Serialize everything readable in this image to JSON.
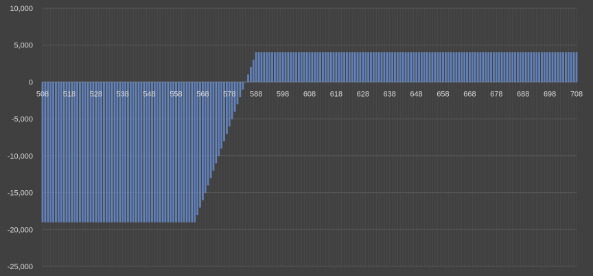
{
  "chart_data": {
    "type": "bar",
    "title": "",
    "xlabel": "",
    "ylabel": "",
    "x_range": [
      508,
      708
    ],
    "ylim": [
      -25000,
      10000
    ],
    "y_ticks": [
      10000,
      5000,
      0,
      -5000,
      -10000,
      -15000,
      -20000,
      -25000
    ],
    "y_tick_labels": [
      "10,000",
      "5,000",
      "0",
      "-5,000",
      "-10,000",
      "-15,000",
      "-20,000",
      "-25,000"
    ],
    "x_tick_labels": [
      "508",
      "518",
      "528",
      "538",
      "548",
      "558",
      "568",
      "578",
      "588",
      "598",
      "608",
      "618",
      "628",
      "638",
      "648",
      "658",
      "668",
      "678",
      "688",
      "698",
      "708"
    ],
    "grid": true,
    "legend": "none",
    "series": [
      {
        "description": "payoff per strike: -19000 for x <= 565, rising linearly by 1000 per unit to 4000 at x >= 588",
        "points": [
          [
            508,
            -19000
          ],
          [
            509,
            -19000
          ],
          [
            510,
            -19000
          ],
          [
            511,
            -19000
          ],
          [
            512,
            -19000
          ],
          [
            513,
            -19000
          ],
          [
            514,
            -19000
          ],
          [
            515,
            -19000
          ],
          [
            516,
            -19000
          ],
          [
            517,
            -19000
          ],
          [
            518,
            -19000
          ],
          [
            519,
            -19000
          ],
          [
            520,
            -19000
          ],
          [
            521,
            -19000
          ],
          [
            522,
            -19000
          ],
          [
            523,
            -19000
          ],
          [
            524,
            -19000
          ],
          [
            525,
            -19000
          ],
          [
            526,
            -19000
          ],
          [
            527,
            -19000
          ],
          [
            528,
            -19000
          ],
          [
            529,
            -19000
          ],
          [
            530,
            -19000
          ],
          [
            531,
            -19000
          ],
          [
            532,
            -19000
          ],
          [
            533,
            -19000
          ],
          [
            534,
            -19000
          ],
          [
            535,
            -19000
          ],
          [
            536,
            -19000
          ],
          [
            537,
            -19000
          ],
          [
            538,
            -19000
          ],
          [
            539,
            -19000
          ],
          [
            540,
            -19000
          ],
          [
            541,
            -19000
          ],
          [
            542,
            -19000
          ],
          [
            543,
            -19000
          ],
          [
            544,
            -19000
          ],
          [
            545,
            -19000
          ],
          [
            546,
            -19000
          ],
          [
            547,
            -19000
          ],
          [
            548,
            -19000
          ],
          [
            549,
            -19000
          ],
          [
            550,
            -19000
          ],
          [
            551,
            -19000
          ],
          [
            552,
            -19000
          ],
          [
            553,
            -19000
          ],
          [
            554,
            -19000
          ],
          [
            555,
            -19000
          ],
          [
            556,
            -19000
          ],
          [
            557,
            -19000
          ],
          [
            558,
            -19000
          ],
          [
            559,
            -19000
          ],
          [
            560,
            -19000
          ],
          [
            561,
            -19000
          ],
          [
            562,
            -19000
          ],
          [
            563,
            -19000
          ],
          [
            564,
            -19000
          ],
          [
            565,
            -19000
          ],
          [
            566,
            -18000
          ],
          [
            567,
            -17000
          ],
          [
            568,
            -16000
          ],
          [
            569,
            -15000
          ],
          [
            570,
            -14000
          ],
          [
            571,
            -13000
          ],
          [
            572,
            -12000
          ],
          [
            573,
            -11000
          ],
          [
            574,
            -10000
          ],
          [
            575,
            -9000
          ],
          [
            576,
            -8000
          ],
          [
            577,
            -7000
          ],
          [
            578,
            -6000
          ],
          [
            579,
            -5000
          ],
          [
            580,
            -4000
          ],
          [
            581,
            -3000
          ],
          [
            582,
            -2000
          ],
          [
            583,
            -1000
          ],
          [
            584,
            0
          ],
          [
            585,
            1000
          ],
          [
            586,
            2000
          ],
          [
            587,
            3000
          ],
          [
            588,
            4000
          ],
          [
            589,
            4000
          ],
          [
            590,
            4000
          ],
          [
            591,
            4000
          ],
          [
            592,
            4000
          ],
          [
            593,
            4000
          ],
          [
            594,
            4000
          ],
          [
            595,
            4000
          ],
          [
            596,
            4000
          ],
          [
            597,
            4000
          ],
          [
            598,
            4000
          ],
          [
            599,
            4000
          ],
          [
            600,
            4000
          ],
          [
            601,
            4000
          ],
          [
            602,
            4000
          ],
          [
            603,
            4000
          ],
          [
            604,
            4000
          ],
          [
            605,
            4000
          ],
          [
            606,
            4000
          ],
          [
            607,
            4000
          ],
          [
            608,
            4000
          ],
          [
            609,
            4000
          ],
          [
            610,
            4000
          ],
          [
            611,
            4000
          ],
          [
            612,
            4000
          ],
          [
            613,
            4000
          ],
          [
            614,
            4000
          ],
          [
            615,
            4000
          ],
          [
            616,
            4000
          ],
          [
            617,
            4000
          ],
          [
            618,
            4000
          ],
          [
            619,
            4000
          ],
          [
            620,
            4000
          ],
          [
            621,
            4000
          ],
          [
            622,
            4000
          ],
          [
            623,
            4000
          ],
          [
            624,
            4000
          ],
          [
            625,
            4000
          ],
          [
            626,
            4000
          ],
          [
            627,
            4000
          ],
          [
            628,
            4000
          ],
          [
            629,
            4000
          ],
          [
            630,
            4000
          ],
          [
            631,
            4000
          ],
          [
            632,
            4000
          ],
          [
            633,
            4000
          ],
          [
            634,
            4000
          ],
          [
            635,
            4000
          ],
          [
            636,
            4000
          ],
          [
            637,
            4000
          ],
          [
            638,
            4000
          ],
          [
            639,
            4000
          ],
          [
            640,
            4000
          ],
          [
            641,
            4000
          ],
          [
            642,
            4000
          ],
          [
            643,
            4000
          ],
          [
            644,
            4000
          ],
          [
            645,
            4000
          ],
          [
            646,
            4000
          ],
          [
            647,
            4000
          ],
          [
            648,
            4000
          ],
          [
            649,
            4000
          ],
          [
            650,
            4000
          ],
          [
            651,
            4000
          ],
          [
            652,
            4000
          ],
          [
            653,
            4000
          ],
          [
            654,
            4000
          ],
          [
            655,
            4000
          ],
          [
            656,
            4000
          ],
          [
            657,
            4000
          ],
          [
            658,
            4000
          ],
          [
            659,
            4000
          ],
          [
            660,
            4000
          ],
          [
            661,
            4000
          ],
          [
            662,
            4000
          ],
          [
            663,
            4000
          ],
          [
            664,
            4000
          ],
          [
            665,
            4000
          ],
          [
            666,
            4000
          ],
          [
            667,
            4000
          ],
          [
            668,
            4000
          ],
          [
            669,
            4000
          ],
          [
            670,
            4000
          ],
          [
            671,
            4000
          ],
          [
            672,
            4000
          ],
          [
            673,
            4000
          ],
          [
            674,
            4000
          ],
          [
            675,
            4000
          ],
          [
            676,
            4000
          ],
          [
            677,
            4000
          ],
          [
            678,
            4000
          ],
          [
            679,
            4000
          ],
          [
            680,
            4000
          ],
          [
            681,
            4000
          ],
          [
            682,
            4000
          ],
          [
            683,
            4000
          ],
          [
            684,
            4000
          ],
          [
            685,
            4000
          ],
          [
            686,
            4000
          ],
          [
            687,
            4000
          ],
          [
            688,
            4000
          ],
          [
            689,
            4000
          ],
          [
            690,
            4000
          ],
          [
            691,
            4000
          ],
          [
            692,
            4000
          ],
          [
            693,
            4000
          ],
          [
            694,
            4000
          ],
          [
            695,
            4000
          ],
          [
            696,
            4000
          ],
          [
            697,
            4000
          ],
          [
            698,
            4000
          ],
          [
            699,
            4000
          ],
          [
            700,
            4000
          ],
          [
            701,
            4000
          ],
          [
            702,
            4000
          ],
          [
            703,
            4000
          ],
          [
            704,
            4000
          ],
          [
            705,
            4000
          ],
          [
            706,
            4000
          ],
          [
            707,
            4000
          ],
          [
            708,
            4000
          ]
        ]
      }
    ]
  },
  "colors": {
    "background": "#404040",
    "bar_fill": "#5b7fbd",
    "bar_edge": "#7a9bd6",
    "gridline": "#595959",
    "minor_gridline": "#4a4a4a",
    "tick_text": "#d9d9d9"
  }
}
